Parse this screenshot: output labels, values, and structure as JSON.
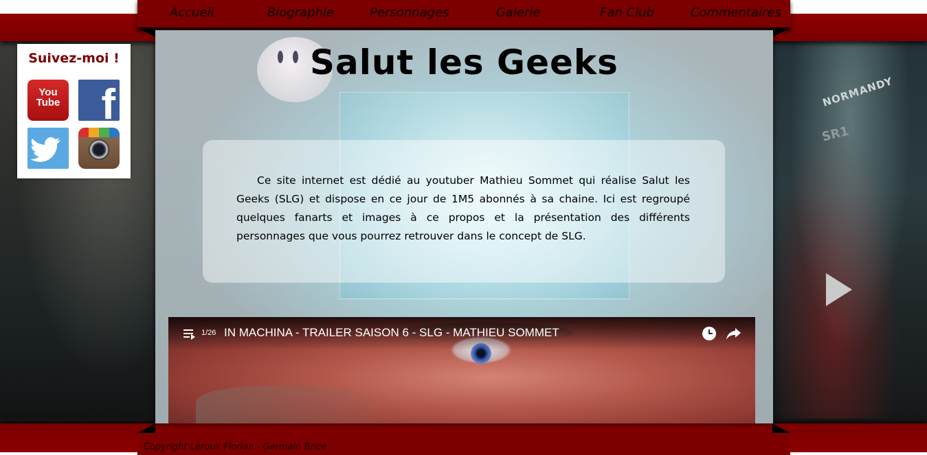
{
  "nav": {
    "items": [
      {
        "label": "Accueil"
      },
      {
        "label": "Biographie"
      },
      {
        "label": "Personnages"
      },
      {
        "label": "Galerie"
      },
      {
        "label": "Fan Club"
      },
      {
        "label": "Commentaires"
      }
    ]
  },
  "header": {
    "title": "Salut les Geeks"
  },
  "intro": {
    "text": "Ce site internet est dédié au youtuber Mathieu Sommet qui réalise Salut les Geeks (SLG) et dispose en ce jour de 1M5 abonnés à sa chaine. Ici est regroupé quelques fanarts et images à ce propos et la présentation des différents personnages que vous pourrez retrouver dans le concept de SLG."
  },
  "video": {
    "playlist_count": "1/26",
    "title": "IN MACHINA - TRAILER SAISON 6 - SLG - MATHIEU SOMMET"
  },
  "follow": {
    "title": "Suivez-moi !",
    "youtube_line1": "You",
    "youtube_line2": "Tube",
    "facebook_letter": "f"
  },
  "background": {
    "ship_name": "NORMANDY",
    "ship_code": "SR1"
  },
  "footer": {
    "copyright": "Copyright Leroux Florian - Germain Brice"
  },
  "colors": {
    "brand_red": "#7d0000",
    "band_red": "#8e0000",
    "youtube_red": "#d62828",
    "facebook_blue": "#3b5b9a",
    "twitter_blue": "#5aa9e2"
  }
}
